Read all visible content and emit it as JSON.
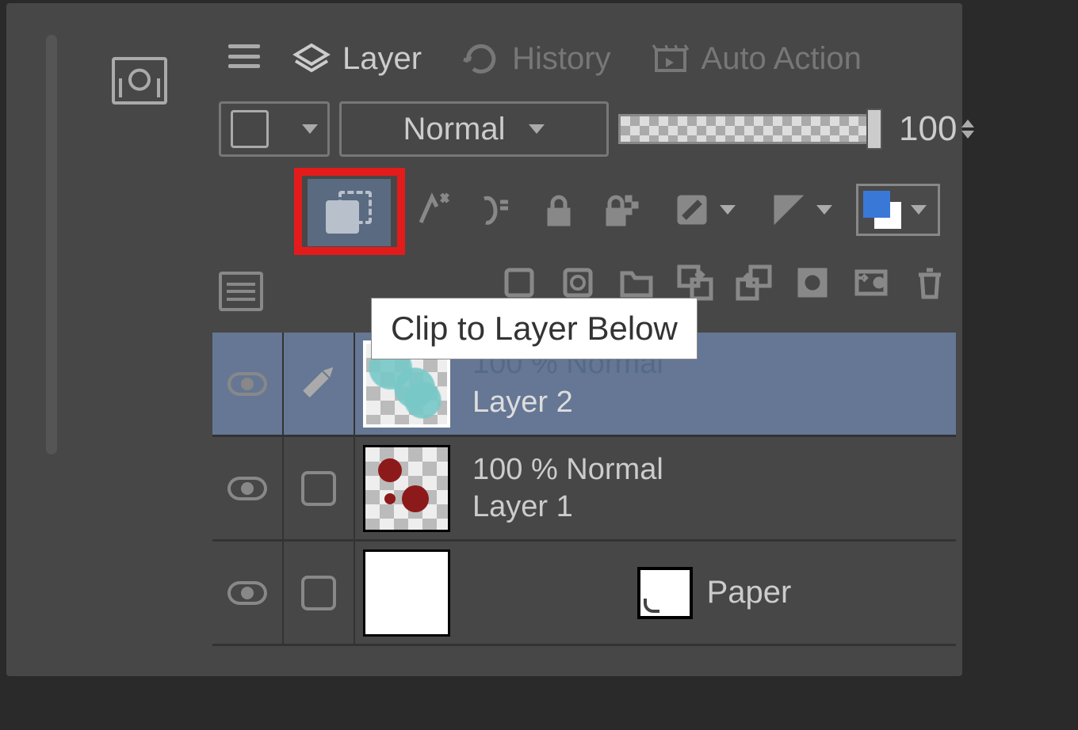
{
  "tabs": {
    "layer": "Layer",
    "history": "History",
    "auto_action": "Auto Action"
  },
  "blend_mode": "Normal",
  "opacity_value": "100",
  "tooltip_text": "Clip to Layer Below",
  "layers": [
    {
      "mode": "100 % Normal",
      "name": "Layer 2"
    },
    {
      "mode": "100 % Normal",
      "name": "Layer 1"
    },
    {
      "name": "Paper"
    }
  ]
}
